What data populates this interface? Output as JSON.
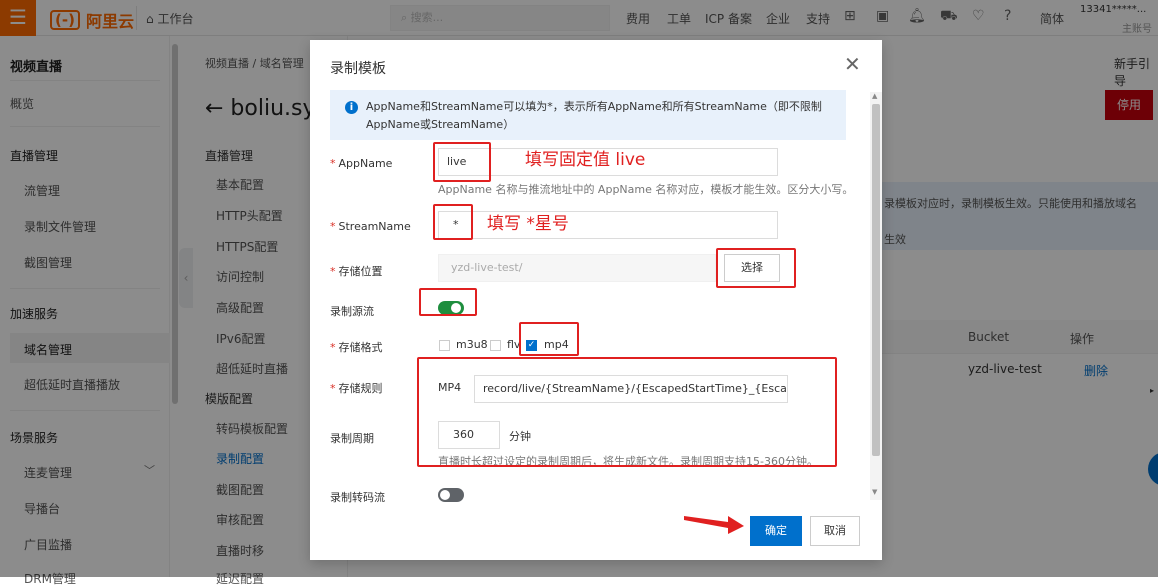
{
  "topbar": {
    "brand": "阿里云",
    "workbench": "工作台",
    "search_placeholder": "搜索...",
    "nav": [
      "费用",
      "工单",
      "ICP 备案",
      "企业",
      "支持"
    ],
    "lang": "简体",
    "user_id": "13341*****...",
    "user_sub": "主账号"
  },
  "sidebar": {
    "title": "视频直播",
    "overview": "概览",
    "sections": [
      {
        "title": "直播管理",
        "items": [
          "流管理",
          "录制文件管理",
          "截图管理"
        ]
      },
      {
        "title": "加速服务",
        "items": [
          "域名管理",
          "超低延时直播播放"
        ]
      },
      {
        "title": "场景服务",
        "items": [
          "连麦管理",
          "导播台",
          "广目监播",
          "DRM管理"
        ]
      }
    ]
  },
  "subnav": {
    "breadcrumb": "视频直播 / 域名管理",
    "page_title": "← boliu.sy",
    "sections": [
      {
        "title": "直播管理",
        "items": [
          "基本配置",
          "HTTP头配置",
          "HTTPS配置",
          "访问控制",
          "高级配置",
          "IPv6配置",
          "超低延时直播"
        ]
      },
      {
        "title": "模版配置",
        "items": [
          "转码模板配置",
          "录制配置",
          "截图配置",
          "审核配置",
          "直播时移",
          "延迟配置"
        ]
      }
    ]
  },
  "main": {
    "newbie_guide": "新手引导",
    "stop_button": "停用",
    "notice_line1": "录模板对应时，录制模板生效。只能使用和播放域名",
    "notice_line2": "生效",
    "table_headers": [
      "Bucket",
      "操作"
    ],
    "table_row": {
      "bucket": "yzd-live-test",
      "action": "删除"
    }
  },
  "dialog": {
    "title": "录制模板",
    "info": "AppName和StreamName可以填为*，表示所有AppName和所有StreamName（即不限制AppName或StreamName）",
    "appname_label": "AppName",
    "appname_value": "live",
    "appname_help": "AppName 名称与推流地址中的 AppName 名称对应，模板才能生效。区分大小写。",
    "streamname_label": "StreamName",
    "streamname_value": "*",
    "location_label": "存储位置",
    "location_value": "yzd-live-test/",
    "select_button": "选择",
    "record_source_label": "录制源流",
    "record_source_on": true,
    "format_label": "存储格式",
    "formats": [
      {
        "label": "m3u8",
        "checked": false
      },
      {
        "label": "flv",
        "checked": false
      },
      {
        "label": "mp4",
        "checked": true
      }
    ],
    "rule_label": "存储规则",
    "rule_prefix": "MP4",
    "rule_value": "record/live/{StreamName}/{EscapedStartTime}_{EscapedEndTime}",
    "period_label": "录制周期",
    "period_value": "360",
    "period_unit": "分钟",
    "period_help": "直播时长超过设定的录制周期后，将生成新文件。录制周期支持15-360分钟。",
    "transcode_label": "录制转码流",
    "transcode_on": false,
    "ok_button": "确定",
    "cancel_button": "取消"
  },
  "annotations": {
    "appname_note": "填写固定值 live",
    "streamname_note": "填写 *星号"
  },
  "colors": {
    "brand": "#ff6a00",
    "primary": "#0070cc",
    "toggle_on": "#1e8e3e",
    "annotation": "#e02020",
    "danger": "#c7000b"
  }
}
